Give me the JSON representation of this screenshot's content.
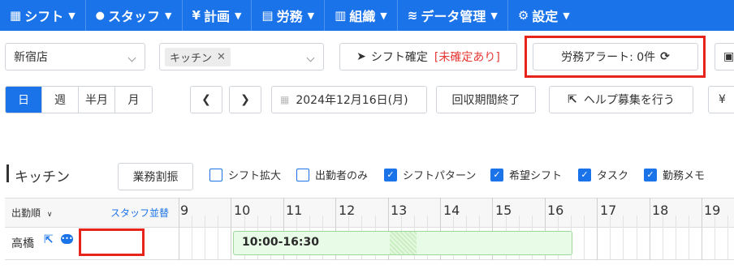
{
  "nav": {
    "items": [
      {
        "icon": "calendar-grid-icon",
        "glyph": "▦",
        "label": "シフト"
      },
      {
        "icon": "user-icon",
        "glyph": "👤",
        "label": "スタッフ"
      },
      {
        "icon": "yen-icon",
        "glyph": "¥",
        "label": "計画"
      },
      {
        "icon": "clipboard-icon",
        "glyph": "▤",
        "label": "労務"
      },
      {
        "icon": "building-icon",
        "glyph": "▥",
        "label": "組織"
      },
      {
        "icon": "database-icon",
        "glyph": "≋",
        "label": "データ管理"
      },
      {
        "icon": "gear-icon",
        "glyph": "⚙",
        "label": "設定"
      }
    ]
  },
  "filters": {
    "store": "新宿店",
    "section_chip": "キッチン",
    "confirm_label": "シフト確定",
    "confirm_status": "[未確定あり]",
    "alert_label": "労務アラート: 0件"
  },
  "view": {
    "modes": [
      "日",
      "週",
      "半月",
      "月"
    ],
    "active_mode": "日",
    "date": "2024年12月16日(月)",
    "period_end_label": "回収期間終了",
    "help_label": "ヘルプ募集を行う",
    "right_clip": "¥"
  },
  "section": {
    "title": "キッチン",
    "assign_button": "業務割振",
    "options": [
      {
        "label": "シフト拡大",
        "checked": false
      },
      {
        "label": "出勤者のみ",
        "checked": false
      },
      {
        "label": "シフトパターン",
        "checked": true
      },
      {
        "label": "希望シフト",
        "checked": true
      },
      {
        "label": "タスク",
        "checked": true
      },
      {
        "label": "勤務メモ",
        "checked": true
      }
    ]
  },
  "table": {
    "sort_label": "出勤順",
    "staff_sort_link": "スタッフ並替",
    "hours": [
      "9",
      "10",
      "11",
      "12",
      "13",
      "14",
      "15",
      "16",
      "17",
      "18",
      "19"
    ],
    "rows": [
      {
        "name": "高橋",
        "shift": "10:00-16:30"
      }
    ]
  },
  "colors": {
    "brand": "#1a73e8",
    "alert_red": "#e53935",
    "highlight_box": "#e8231a",
    "shift_fill": "#e8fbe6"
  }
}
